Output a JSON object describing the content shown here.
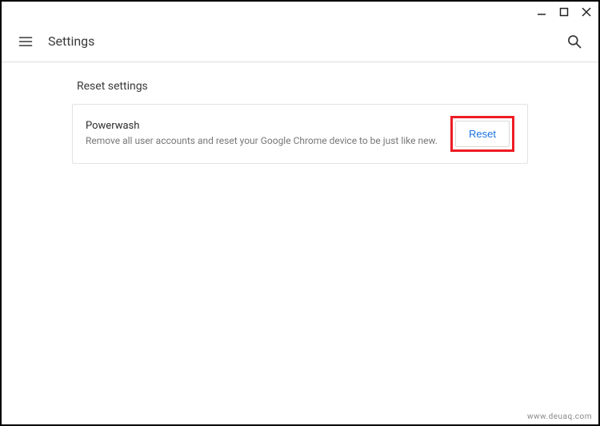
{
  "header": {
    "title": "Settings"
  },
  "section": {
    "title": "Reset settings"
  },
  "card": {
    "title": "Powerwash",
    "description": "Remove all user accounts and reset your Google Chrome device to be just like new.",
    "button_label": "Reset"
  },
  "watermark": "www.deuaq.com"
}
